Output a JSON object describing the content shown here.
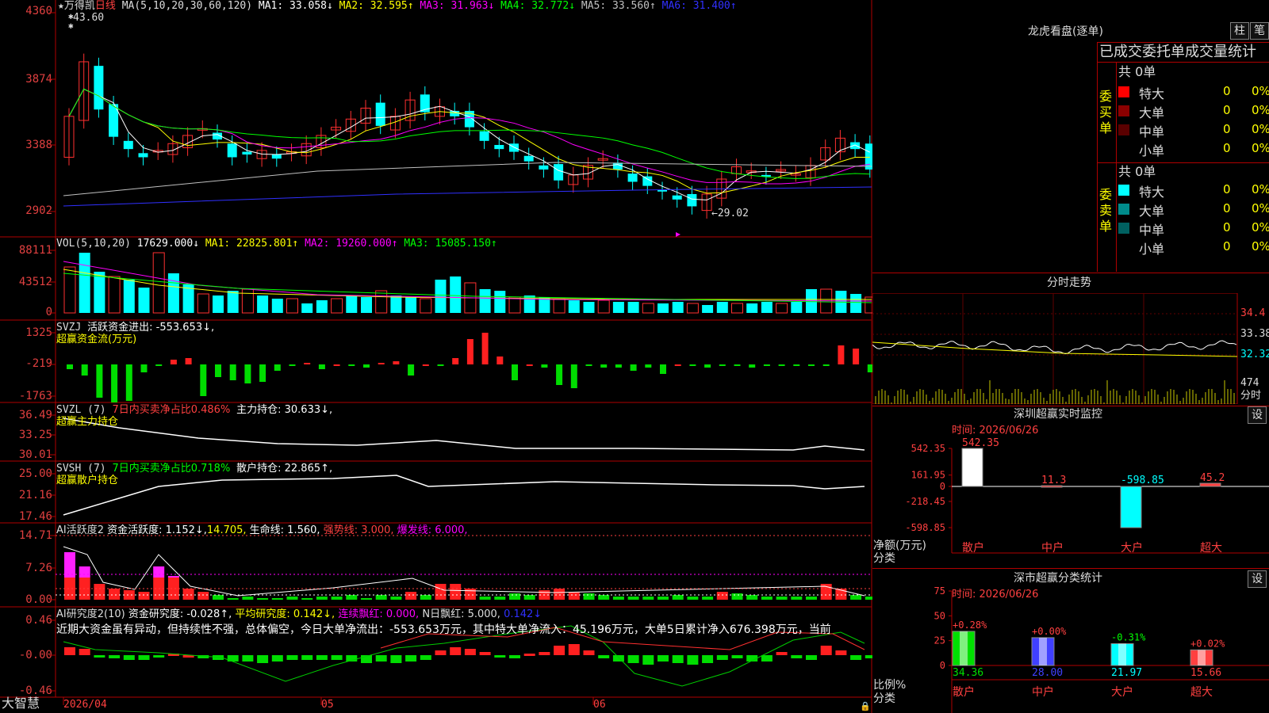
{
  "stock": {
    "star": "★",
    "name": "万得凯",
    "period": "日线",
    "ma_label": "MA(5,10,20,30,60,120)",
    "ma1": "MA1: 33.058↓",
    "ma2": "MA2: 32.595↑",
    "ma3": "MA3: 31.963↓",
    "ma4": "MA4: 32.772↓",
    "ma5": "MA5: 33.560↑",
    "ma6": "MA6: 31.400↑",
    "high_mark": "43.60",
    "low_mark": "←29.02",
    "y_ticks": [
      "4360",
      "3874",
      "3388",
      "2902"
    ]
  },
  "vol": {
    "label": "VOL(5,10,20)",
    "value": "17629.000↓",
    "ma1": "MA1: 22825.801↑",
    "ma2": "MA2: 19260.000↑",
    "ma3": "MA3: 15085.150↑",
    "y_ticks": [
      "88111",
      "43512",
      "0"
    ]
  },
  "svzj": {
    "label": "SVZJ",
    "item": "活跃资金进出: -553.653↓,",
    "sub": "超赢资金流(万元)",
    "y_ticks": [
      "1325",
      "-219",
      "-1763"
    ]
  },
  "svzl": {
    "label": "SVZL (7)",
    "ratio": "7日内买卖净占比0.486%",
    "hold": "主力持仓: 30.633↓,",
    "sub": "超赢主力持仓",
    "y_ticks": [
      "36.49",
      "33.25",
      "30.01"
    ]
  },
  "svsh": {
    "label": "SVSH (7)",
    "ratio": "7日内买卖净占比0.718%",
    "hold": "散户持仓: 22.865↑,",
    "sub": "超赢散户持仓",
    "y_ticks": [
      "25.00",
      "21.16",
      "17.46"
    ]
  },
  "ai1": {
    "label": "AI活跃度2",
    "a": "资金活跃度: 1.152↓,",
    "b": "14.705,",
    "c": "生命线: 1.560,",
    "d": "强势线: 3.000,",
    "e": "爆发线: 6.000,",
    "y_ticks": [
      "14.71",
      "7.26",
      "0.00"
    ]
  },
  "ai2": {
    "label": "AI研究度2(10)",
    "a": "资金研究度: -0.028↑,",
    "b": "平均研究度: 0.142↓,",
    "c": "连续飘红: 0.000,",
    "d": "N日飘红: 5.000,",
    "e": "0.142↓",
    "note": "近期大资金虽有异动，但持续性不强，总体偏空，今日大单净流出：-553.653万元，其中特大单净流入：45.196万元，大单5日累计净入676.398万元，当前",
    "y_ticks": [
      "0.46",
      "-0.00",
      "-0.46"
    ]
  },
  "bottom": {
    "brand": "大智慧",
    "dates": [
      "2026/04",
      "05",
      "06"
    ]
  },
  "longhu": {
    "title": "龙虎看盘(逐单)",
    "btn1": "柱",
    "btn2": "笔",
    "stats_title": "已成交委托单成交量统计",
    "buy_label": "委买单",
    "sell_label": "委卖单",
    "buy_total": "共 0单",
    "sell_total": "共 0单",
    "buy_rows": [
      {
        "name": "特大",
        "v": "0",
        "p": "0%",
        "color": "#ff0000"
      },
      {
        "name": "大单",
        "v": "0",
        "p": "0%",
        "color": "#8b0000"
      },
      {
        "name": "中单",
        "v": "0",
        "p": "0%",
        "color": "#5a0000"
      },
      {
        "name": "小单",
        "v": "0",
        "p": "0%",
        "color": "#000000"
      }
    ],
    "sell_rows": [
      {
        "name": "特大",
        "v": "0",
        "p": "0%",
        "color": "#00ffff"
      },
      {
        "name": "大单",
        "v": "0",
        "p": "0%",
        "color": "#008b8b"
      },
      {
        "name": "中单",
        "v": "0",
        "p": "0%",
        "color": "#006060"
      },
      {
        "name": "小单",
        "v": "0",
        "p": "0%",
        "color": "#000000"
      }
    ]
  },
  "intraday": {
    "title": "分时走势",
    "prices": [
      "34.4",
      "33.38",
      "32.32"
    ],
    "vol": "474",
    "unit": "分时"
  },
  "sz_monitor": {
    "title": "深圳超赢实时监控",
    "btn": "设",
    "time": "时间: 2026/06/26",
    "unit": "净额(万元)",
    "cat": "分类",
    "y_ticks": [
      "542.35",
      "161.95",
      "0",
      "-218.45",
      "-598.85"
    ],
    "bars": [
      {
        "name": "散户",
        "value": 542.35,
        "label": "542.35",
        "color": "#ffffff"
      },
      {
        "name": "中户",
        "value": 11.3,
        "label": "11.3",
        "color": "#ff4040"
      },
      {
        "name": "大户",
        "value": -598.85,
        "label": "-598.85",
        "color": "#00ffff"
      },
      {
        "name": "超大",
        "value": 45.2,
        "label": "45.2",
        "color": "#ff4040"
      }
    ]
  },
  "sz_class": {
    "title": "深市超赢分类统计",
    "btn": "设",
    "time": "时间: 2026/06/26",
    "unit": "比例%",
    "cat": "分类",
    "y_ticks": [
      "75",
      "50",
      "25",
      "0"
    ],
    "bars": [
      {
        "name": "散户",
        "value": 34.36,
        "label": "34.36",
        "chg": "+0.28%",
        "color": "#00e000"
      },
      {
        "name": "中户",
        "value": 28.0,
        "label": "28.00",
        "chg": "+0.00%",
        "color": "#4040ff"
      },
      {
        "name": "大户",
        "value": 21.97,
        "label": "21.97",
        "chg": "-0.31%",
        "color": "#00ffff"
      },
      {
        "name": "超大",
        "value": 15.66,
        "label": "15.66",
        "chg": "+0.02%",
        "color": "#ff4040"
      }
    ]
  }
}
